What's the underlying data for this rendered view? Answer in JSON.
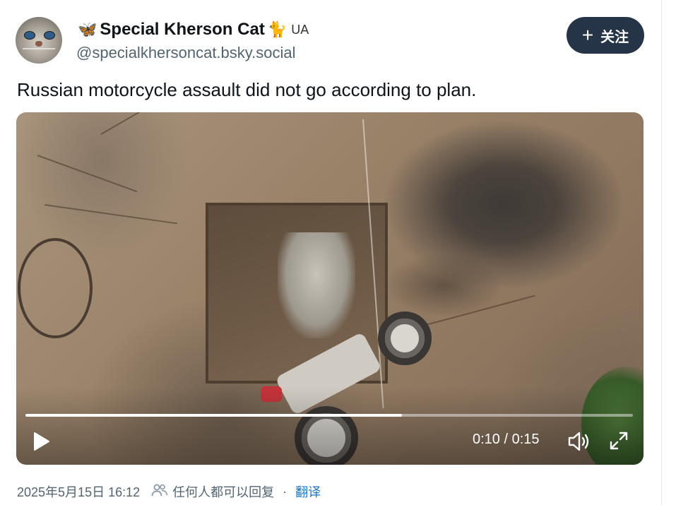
{
  "profile": {
    "display_name": "Special Kherson Cat",
    "prefix_emoji": "🦋",
    "suffix_emoji": "🐈",
    "flag_code": "UA",
    "handle": "@specialkhersoncat.bsky.social",
    "avatar_icon": "cat-avatar"
  },
  "follow": {
    "icon": "+",
    "label": "关注",
    "color": "#263448"
  },
  "post": {
    "text": "Russian motorcycle assault did not go according to plan."
  },
  "video": {
    "progress": 0.62,
    "time": "0:10 / 0:15",
    "controls": [
      "play-icon",
      "volume-icon",
      "fullscreen-icon"
    ]
  },
  "meta": {
    "timestamp": "2025年5月15日 16:12",
    "reply_scope": "任何人都可以回复",
    "separator": "·",
    "translate": "翻译",
    "link_color": "#1d75c9"
  }
}
